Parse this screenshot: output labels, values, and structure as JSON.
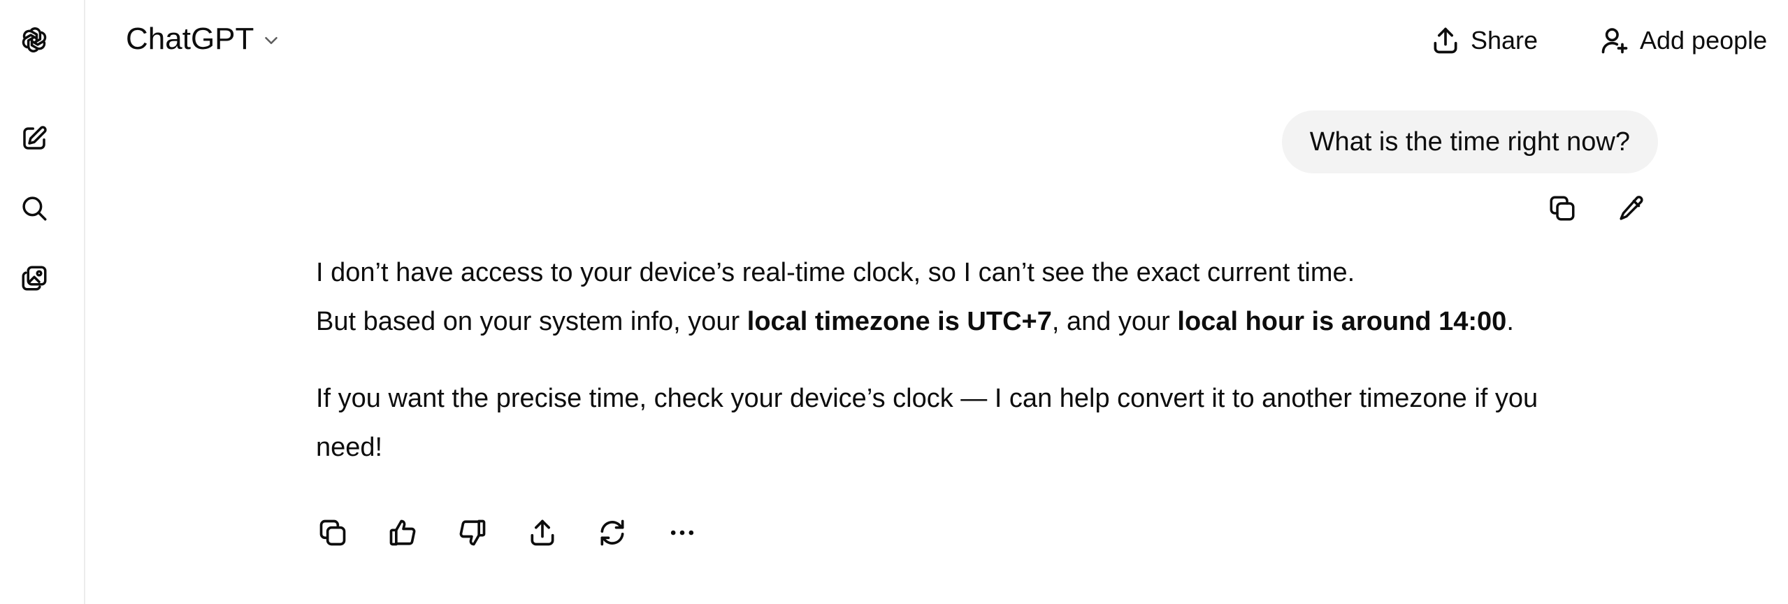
{
  "header": {
    "model_label": "ChatGPT",
    "share_label": "Share",
    "add_people_label": "Add people"
  },
  "rail": {
    "icons": [
      "openai-logo-icon",
      "new-chat-icon",
      "search-icon",
      "library-icon"
    ]
  },
  "conversation": {
    "user_message": "What is the time right now?",
    "assistant": {
      "line1": "I don’t have access to your device’s real-time clock, so I can’t see the exact current time.",
      "line2_a": "But based on your system info, your ",
      "line2_b": "local timezone is UTC+7",
      "line2_c": ", and your ",
      "line2_d": "local hour is around 14:00",
      "line2_e": ".",
      "para2": "If you want the precise time, check your device’s clock — I can help convert it to another timezone if you need!"
    }
  },
  "colors": {
    "bubble_bg": "#f3f3f3",
    "text": "#0d0d0d",
    "divider": "#ececec"
  }
}
